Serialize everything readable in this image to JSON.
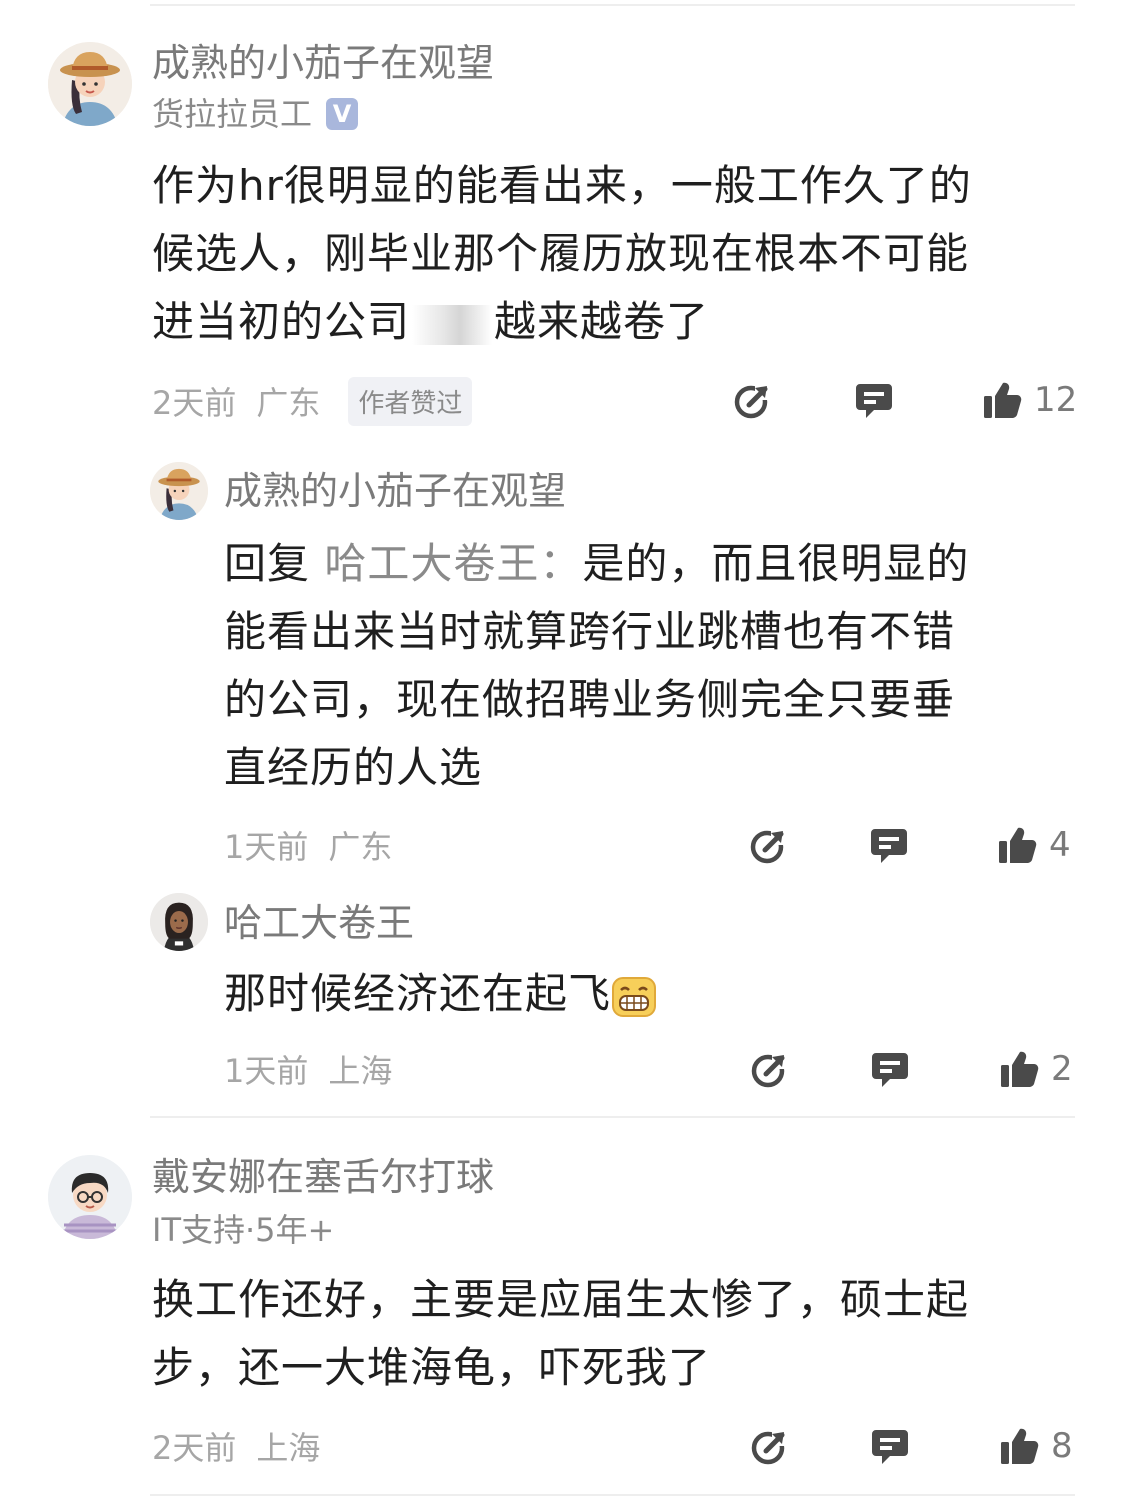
{
  "comments": [
    {
      "author": "成熟的小茄子在观望",
      "badge": "货拉拉员工",
      "verified": true,
      "lines": [
        "作为hr很明显的能看出来，一般工作久了的",
        "候选人，刚毕业那个履历放现在根本不可能",
        "进当初的公司"
      ],
      "line3_tail": "越来越卷了",
      "time": "2天前",
      "location": "广东",
      "tag": "作者赞过",
      "likes": "12"
    },
    {
      "author": "成熟的小茄子在观望",
      "reply_prefix": "回复",
      "reply_to": "哈工大卷王：",
      "lines": [
        "是的，而且很明显的",
        "能看出来当时就算跨行业跳槽也有不错",
        "的公司，现在做招聘业务侧完全只要垂",
        "直经历的人选"
      ],
      "time": "1天前",
      "location": "广东",
      "likes": "4"
    },
    {
      "author": "哈工大卷王",
      "text": "那时候经济还在起飞",
      "emoji_icon": "grin-emoji-icon",
      "time": "1天前",
      "location": "上海",
      "likes": "2"
    },
    {
      "author": "戴安娜在塞舌尔打球",
      "badge": "IT支持·5年+",
      "lines": [
        "换工作还好，主要是应届生太惨了，硕士起",
        "步，还一大堆海龟，吓死我了"
      ],
      "time": "2天前",
      "location": "上海",
      "likes": "8"
    }
  ],
  "icons": {
    "share": "share-icon",
    "comment": "comment-icon",
    "like": "thumbs-up-icon"
  },
  "colors": {
    "verified_badge": "#a9b7dc",
    "icon": "#4a4a4a",
    "muted_text": "#a6a6a6"
  }
}
